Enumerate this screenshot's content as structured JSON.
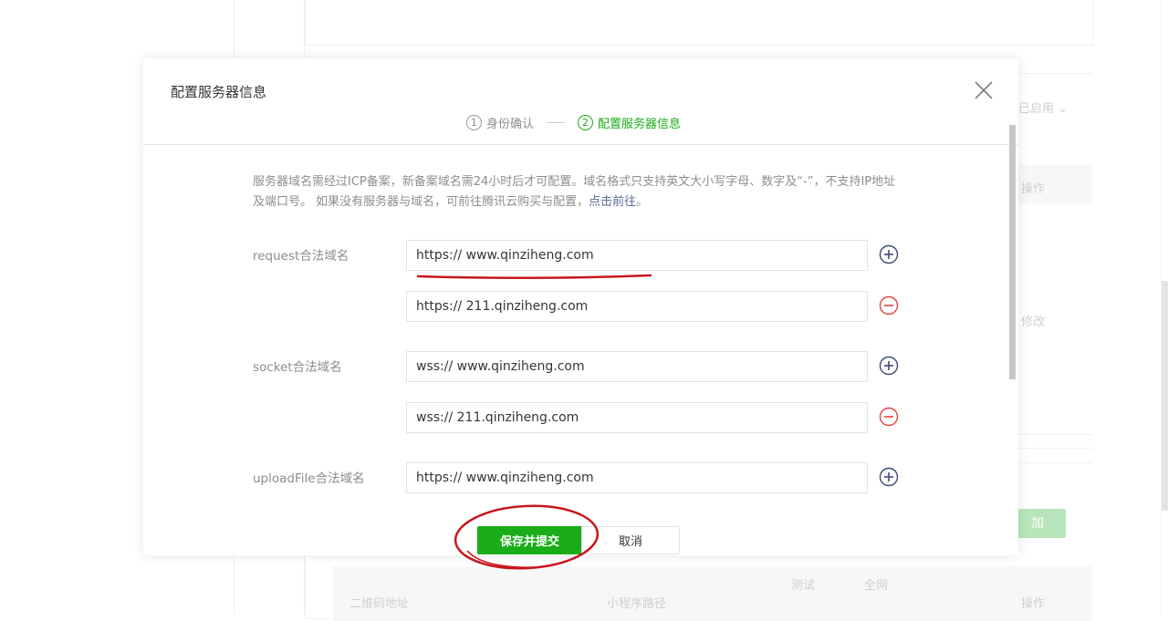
{
  "background": {
    "status_text": "已启用",
    "col_action_1": "操作",
    "row_edit": "修改",
    "add_button": "加",
    "col_test": "测试",
    "col_full_network": "全网",
    "col_qrcode_address": "二维码地址",
    "col_miniprogram_path": "小程序路径",
    "col_action_2": "操作"
  },
  "dialog": {
    "title": "配置服务器信息",
    "steps": [
      {
        "num": "1",
        "label": "身份确认"
      },
      {
        "num": "2",
        "label": "配置服务器信息"
      }
    ],
    "notice_text": "服务器域名需经过ICP备案，新备案域名需24小时后才可配置。域名格式只支持英文大小写字母、数字及“-”，不支持IP地址及端口号。 如果没有服务器与域名，可前往腾讯云购买与配置，",
    "notice_link": "点击前往",
    "notice_end": "。",
    "fields": {
      "request_label": "request合法域名",
      "request_1": "https:// www.qinziheng.com",
      "request_2": "https:// 211.qinziheng.com",
      "socket_label": "socket合法域名",
      "socket_1": "wss:// www.qinziheng.com",
      "socket_2": "wss:// 211.qinziheng.com",
      "upload_label": "uploadFile合法域名",
      "upload_1": "https:// www.qinziheng.com"
    },
    "save_button": "保存并提交",
    "cancel_button": "取消"
  },
  "colors": {
    "primary_green": "#1aad19",
    "link_blue": "#576b95",
    "add_icon": "#3c4a78",
    "remove_icon": "#e64340",
    "annotation_red": "#c8161d"
  }
}
